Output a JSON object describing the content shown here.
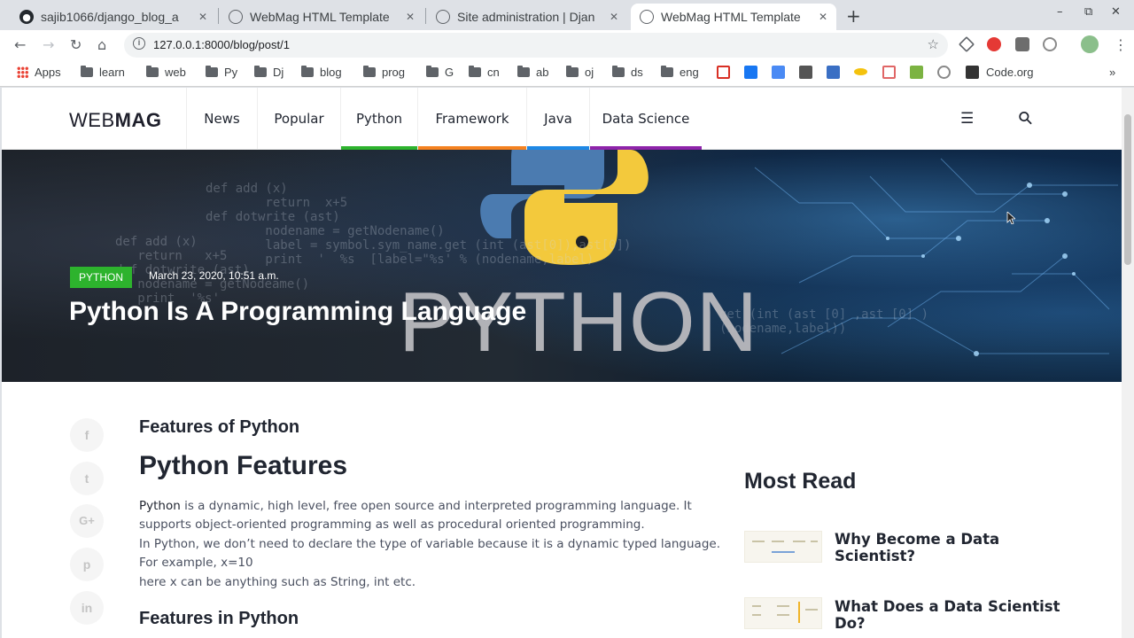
{
  "browser": {
    "tabs": [
      {
        "title": "sajib1066/django_blog_a",
        "favicon": "github-icon",
        "active": false
      },
      {
        "title": "WebMag HTML Template",
        "favicon": "globe-icon",
        "active": false
      },
      {
        "title": "Site administration | Djan",
        "favicon": "globe-icon",
        "active": false
      },
      {
        "title": "WebMag HTML Template",
        "favicon": "globe-icon",
        "active": true
      }
    ],
    "new_tab_label": "+",
    "close_glyph": "✕",
    "url": "127.0.0.1:8000/blog/post/1",
    "window_controls": [
      "–",
      "⧉",
      "✕"
    ]
  },
  "bookmarks": [
    {
      "label": "Apps",
      "kind": "apps"
    },
    {
      "label": "learn",
      "kind": "folder"
    },
    {
      "label": "web",
      "kind": "folder"
    },
    {
      "label": "Py",
      "kind": "folder"
    },
    {
      "label": "Dj",
      "kind": "folder"
    },
    {
      "label": "blog",
      "kind": "folder"
    },
    {
      "label": "prog",
      "kind": "folder"
    },
    {
      "label": "G",
      "kind": "folder"
    },
    {
      "label": "cn",
      "kind": "folder"
    },
    {
      "label": "ab",
      "kind": "folder"
    },
    {
      "label": "oj",
      "kind": "folder"
    },
    {
      "label": "ds",
      "kind": "folder"
    },
    {
      "label": "eng",
      "kind": "folder"
    },
    {
      "label": "Code.org",
      "kind": "site"
    }
  ],
  "bookmarks_overflow": "»",
  "site": {
    "logo_light": "WEB",
    "logo_bold": "MAG",
    "nav": [
      {
        "label": "News",
        "color": ""
      },
      {
        "label": "Popular",
        "color": ""
      },
      {
        "label": "Python",
        "color": "#2db32d"
      },
      {
        "label": "Framework",
        "color": "#f58220"
      },
      {
        "label": "Java",
        "color": "#1e88e5"
      },
      {
        "label": "Data Science",
        "color": "#8e24aa"
      }
    ],
    "menu_icon": "☰",
    "search_icon": "⚲"
  },
  "hero": {
    "category": "PYTHON",
    "date": "March 23, 2020, 10:51 a.m.",
    "title": "Python Is A Programming Language",
    "image_word": "PYTHON"
  },
  "share_buttons": [
    {
      "icon": "facebook-icon",
      "glyph": "f"
    },
    {
      "icon": "twitter-icon",
      "glyph": "t"
    },
    {
      "icon": "google-plus-icon",
      "glyph": "G+"
    },
    {
      "icon": "pinterest-icon",
      "glyph": "p"
    },
    {
      "icon": "linkedin-icon",
      "glyph": "in"
    }
  ],
  "article": {
    "subtitle": "Features of Python",
    "heading": "Python Features",
    "para_bold": "Python",
    "para_line1": " is a dynamic, high level, free open source and interpreted programming language. It",
    "para_line2": "supports object-oriented programming as well as procedural oriented programming.",
    "para_line3": "In Python, we don’t need to declare the type of variable because it is a dynamic typed language.",
    "para_line4": "For example, x=10",
    "para_line5": "here x can be anything such as String, int etc.",
    "section2": "Features in Python"
  },
  "sidebar": {
    "most_read_title": "Most Read",
    "posts": [
      {
        "title": "Why Become a Data Scientist?"
      },
      {
        "title": "What Does a Data Scientist Do?"
      }
    ]
  },
  "colors": {
    "python_green": "#2db32d",
    "framework_orange": "#f58220",
    "java_blue": "#1e88e5",
    "datascience_purple": "#8e24aa"
  }
}
